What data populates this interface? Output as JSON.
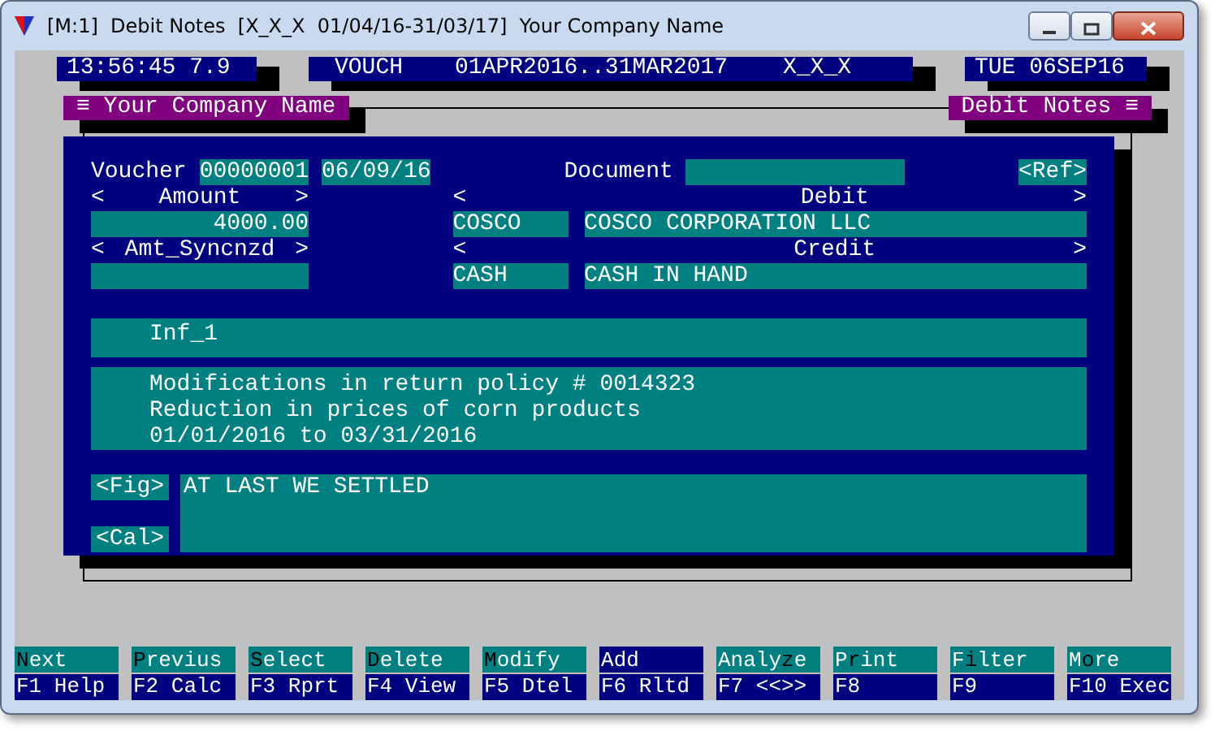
{
  "window": {
    "title": "[M:1]  Debit Notes  [X_X_X  01/04/16-31/03/17]  Your Company Name"
  },
  "status": {
    "clock": "13:56:45 7.9",
    "mode": "VOUCH",
    "period": "01APR2016..31MAR2017",
    "company_code": "X_X_X",
    "date": "TUE 06SEP16"
  },
  "frame": {
    "left_title": "≡ Your Company Name",
    "right_title": "Debit Notes ≡"
  },
  "voucher": {
    "label": "Voucher",
    "number": "00000001",
    "date": "06/09/16",
    "document_label": "Document",
    "ref_button": "<Ref>"
  },
  "amount": {
    "left": "<",
    "label": "Amount",
    "right": ">",
    "value": "4000.00"
  },
  "debit": {
    "left": "<",
    "label": "Debit",
    "right": ">",
    "code": "COSCO",
    "name": "COSCO CORPORATION LLC"
  },
  "amt_sync": {
    "left": "<",
    "label": "Amt_Syncnzd",
    "right": ">"
  },
  "credit": {
    "left": "<",
    "label": "Credit",
    "right": ">",
    "code": "CASH",
    "name": "CASH IN HAND"
  },
  "info_label": "Inf_1",
  "memo_lines": [
    "Modifications in return policy # 0014323",
    "Reduction in prices of corn products",
    "01/01/2016 to 03/31/2016"
  ],
  "fig_button": "<Fig>",
  "cal_button": "<Cal>",
  "remark": "AT LAST WE SETTLED",
  "function_keys": [
    {
      "hotkey": "N",
      "after": "ext",
      "fkey": "F1 Help",
      "selected": false
    },
    {
      "hotkey": "P",
      "after": "revius",
      "fkey": "F2 Calc",
      "selected": false
    },
    {
      "hotkey": "S",
      "after": "elect",
      "fkey": "F3 Rprt",
      "selected": false
    },
    {
      "hotkey": "D",
      "after": "elete",
      "fkey": "F4 View",
      "selected": false
    },
    {
      "hotkey": "M",
      "after": "odify",
      "fkey": "F5 Dtel",
      "selected": false
    },
    {
      "hotkey": "A",
      "after": "dd",
      "fkey": "F6 Rltd",
      "selected": true
    },
    {
      "before": "Analy",
      "hotkey": "z",
      "after": "e",
      "fkey": "F7 <<>>",
      "selected": false
    },
    {
      "before": "P",
      "hotkey": "r",
      "after": "int",
      "fkey": "F8",
      "selected": false
    },
    {
      "before": "F",
      "hotkey": "i",
      "after": "lter",
      "fkey": "F9",
      "selected": false
    },
    {
      "before": "M",
      "hotkey": "o",
      "after": "re",
      "fkey": "F10 Exec",
      "selected": false
    }
  ]
}
